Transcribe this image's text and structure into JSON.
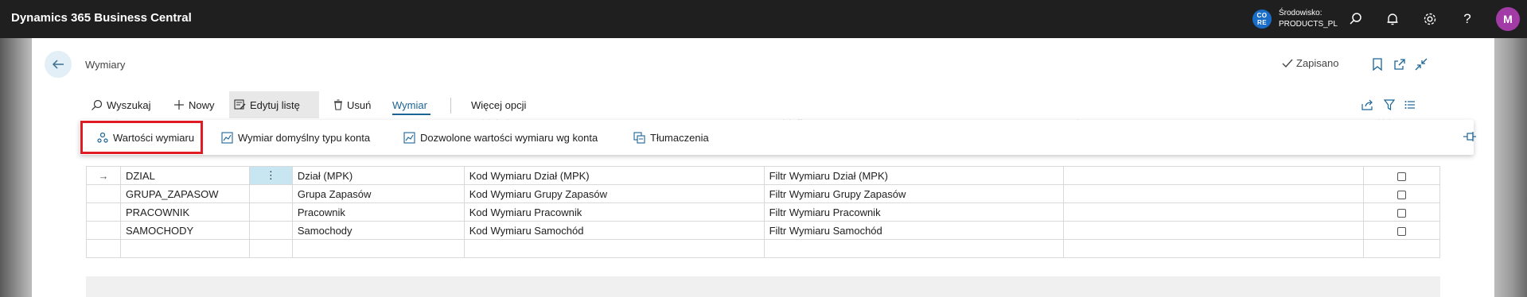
{
  "app": {
    "title": "Dynamics 365 Business Central"
  },
  "environment": {
    "badge": "CO RE",
    "label": "Środowisko:",
    "value": "PRODUCTS_PL"
  },
  "user": {
    "initial": "M"
  },
  "page": {
    "title": "Wymiary",
    "status": "Zapisano"
  },
  "actions": {
    "search": "Wyszukaj",
    "new": "Nowy",
    "edit_list": "Edytuj listę",
    "delete": "Usuń",
    "dimension": "Wymiar",
    "more": "Więcej opcji"
  },
  "sub_actions": {
    "dimension_values": "Wartości wymiaru",
    "default_dimension_account_type": "Wymiar domyślny typu konta",
    "allowed_values_by_account": "Dozwolone wartości wymiaru wg konta",
    "translations": "Tłumaczenia"
  },
  "table": {
    "rows": [
      {
        "code": "DZIAL",
        "name": "Dział (MPK)",
        "code_caption": "Kod Wymiaru Dział (MPK)",
        "filter_caption": "Filtr Wymiaru Dział (MPK)",
        "description": ""
      },
      {
        "code": "GRUPA_ZAPASOW",
        "name": "Grupa Zapasów",
        "code_caption": "Kod Wymiaru Grupy Zapasów",
        "filter_caption": "Filtr Wymiaru Grupy Zapasów",
        "description": ""
      },
      {
        "code": "PRACOWNIK",
        "name": "Pracownik",
        "code_caption": "Kod Wymiaru Pracownik",
        "filter_caption": "Filtr Wymiaru Pracownik",
        "description": ""
      },
      {
        "code": "SAMOCHODY",
        "name": "Samochody",
        "code_caption": "Kod Wymiaru Samochód",
        "filter_caption": "Filtr Wymiaru Samochód",
        "description": ""
      }
    ],
    "row_menu_glyph": "⋮",
    "current_row_glyph": "→"
  },
  "colors": {
    "accent": "#1b6496",
    "topbar": "#1f1f1f",
    "avatar": "#a23ba6",
    "highlight": "#e01b24"
  },
  "icons": [
    "search-icon",
    "bell-icon",
    "gear-icon",
    "help-icon",
    "back-arrow-icon",
    "checkmark-icon",
    "bookmark-icon",
    "open-new-icon",
    "collapse-icon",
    "share-icon",
    "filter-icon",
    "list-icon",
    "pin-icon"
  ]
}
